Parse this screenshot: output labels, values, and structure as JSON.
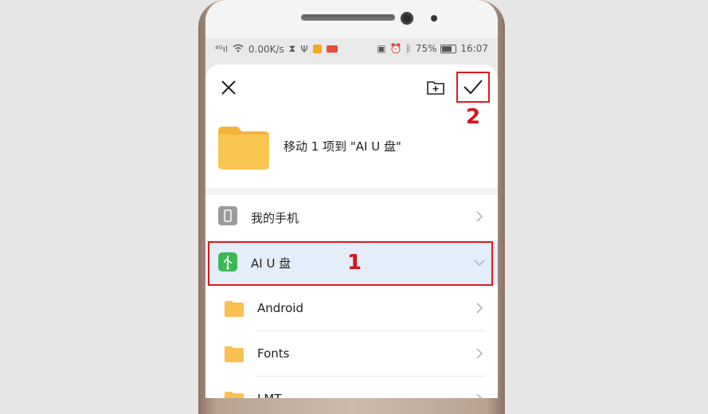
{
  "status_bar": {
    "network_speed": "0.00K/s",
    "battery_percent": "75%",
    "time": "16:07"
  },
  "dialog": {
    "move_text": "移动 1 项到 \"AI U 盘\"",
    "close_icon": "close-icon",
    "new_folder_icon": "new-folder-icon",
    "confirm_icon": "checkmark-icon"
  },
  "list": {
    "items": [
      {
        "label": "我的手机",
        "icon": "phone-icon"
      },
      {
        "label": "AI U 盘",
        "icon": "usb-icon",
        "selected": true
      },
      {
        "label": "Android",
        "icon": "folder-icon"
      },
      {
        "label": "Fonts",
        "icon": "folder-icon"
      },
      {
        "label": "LMT",
        "icon": "folder-icon"
      }
    ]
  },
  "annotations": {
    "step1": "1",
    "step2": "2",
    "highlight_color": "#e0191e"
  },
  "colors": {
    "folder": "#fbc04f",
    "usb": "#3cb853",
    "selected_row": "#e4eefa"
  }
}
